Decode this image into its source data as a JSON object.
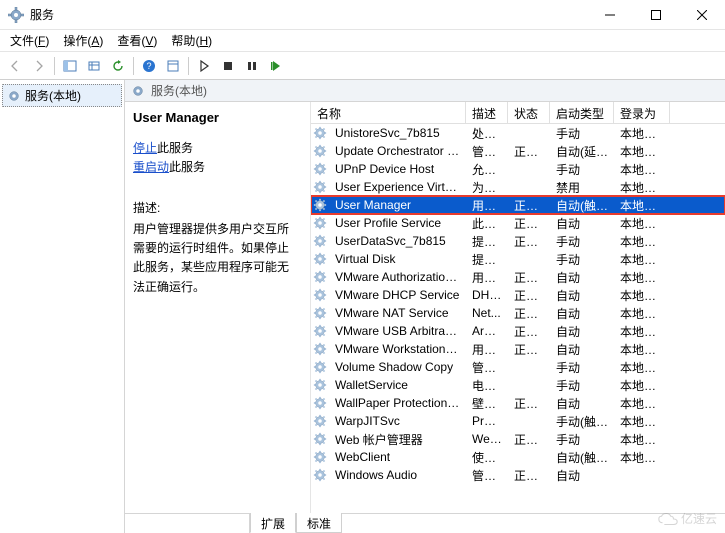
{
  "window": {
    "title": "服务"
  },
  "menubar": {
    "file": {
      "text": "文件",
      "hotkey": "F"
    },
    "action": {
      "text": "操作",
      "hotkey": "A"
    },
    "view": {
      "text": "查看",
      "hotkey": "V"
    },
    "help": {
      "text": "帮助",
      "hotkey": "H"
    }
  },
  "tree": {
    "root": "服务(本地)"
  },
  "right_header": "服务(本地)",
  "detail": {
    "name": "User Manager",
    "stop_prefix": "停止",
    "restart_prefix": "重启动",
    "link_suffix": "此服务",
    "desc_label": "描述:",
    "desc_text": "用户管理器提供多用户交互所需要的运行时组件。如果停止此服务，某些应用程序可能无法正确运行。"
  },
  "grid": {
    "columns": {
      "name": "名称",
      "desc": "描述",
      "status": "状态",
      "startup": "启动类型",
      "logon": "登录为"
    },
    "rows": [
      {
        "name": "UnistoreSvc_7b815",
        "desc": "处理...",
        "status": "",
        "startup": "手动",
        "logon": "本地系统"
      },
      {
        "name": "Update Orchestrator Ser...",
        "desc": "管理 ...",
        "status": "正在...",
        "startup": "自动(延迟...",
        "logon": "本地系统"
      },
      {
        "name": "UPnP Device Host",
        "desc": "允许 ...",
        "status": "",
        "startup": "手动",
        "logon": "本地服务"
      },
      {
        "name": "User Experience Virtualiz...",
        "desc": "为应...",
        "status": "",
        "startup": "禁用",
        "logon": "本地系统"
      },
      {
        "name": "User Manager",
        "desc": "用户...",
        "status": "正在...",
        "startup": "自动(触发...",
        "logon": "本地系统",
        "selected": true
      },
      {
        "name": "User Profile Service",
        "desc": "此服...",
        "status": "正在...",
        "startup": "自动",
        "logon": "本地系统"
      },
      {
        "name": "UserDataSvc_7b815",
        "desc": "提供...",
        "status": "正在...",
        "startup": "手动",
        "logon": "本地系统"
      },
      {
        "name": "Virtual Disk",
        "desc": "提供...",
        "status": "",
        "startup": "手动",
        "logon": "本地系统"
      },
      {
        "name": "VMware Authorization Se...",
        "desc": "用于...",
        "status": "正在...",
        "startup": "自动",
        "logon": "本地系统"
      },
      {
        "name": "VMware DHCP Service",
        "desc": "DHC...",
        "status": "正在...",
        "startup": "自动",
        "logon": "本地系统"
      },
      {
        "name": "VMware NAT Service",
        "desc": "Net...",
        "status": "正在...",
        "startup": "自动",
        "logon": "本地系统"
      },
      {
        "name": "VMware USB Arbitration ...",
        "desc": "Arbit...",
        "status": "正在...",
        "startup": "自动",
        "logon": "本地系统"
      },
      {
        "name": "VMware Workstation Ser...",
        "desc": "用于...",
        "status": "正在...",
        "startup": "自动",
        "logon": "本地系统"
      },
      {
        "name": "Volume Shadow Copy",
        "desc": "管理...",
        "status": "",
        "startup": "手动",
        "logon": "本地系统"
      },
      {
        "name": "WalletService",
        "desc": "电子...",
        "status": "",
        "startup": "手动",
        "logon": "本地系统"
      },
      {
        "name": "WallPaper Protection Ser...",
        "desc": "壁纸...",
        "status": "正在...",
        "startup": "自动",
        "logon": "本地系统"
      },
      {
        "name": "WarpJITSvc",
        "desc": "Prov...",
        "status": "",
        "startup": "手动(触发...",
        "logon": "本地服务"
      },
      {
        "name": "Web 帐户管理器",
        "desc": "Web...",
        "status": "正在...",
        "startup": "手动",
        "logon": "本地系统"
      },
      {
        "name": "WebClient",
        "desc": "使基...",
        "status": "",
        "startup": "自动(触发...",
        "logon": "本地服务"
      },
      {
        "name": "Windows Audio",
        "desc": "管理...",
        "status": "正在...",
        "startup": "自动",
        "logon": ""
      }
    ]
  },
  "tabs": {
    "extended": "扩展",
    "standard": "标准"
  },
  "watermark": "亿速云"
}
